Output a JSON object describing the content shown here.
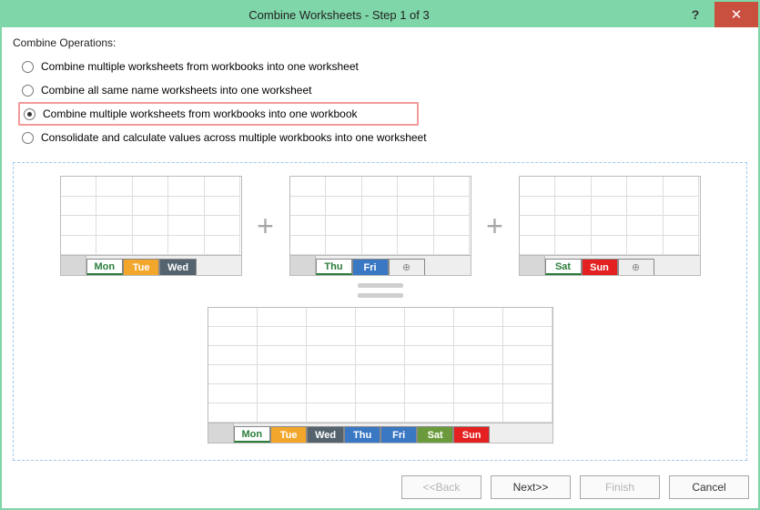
{
  "window": {
    "title": "Combine Worksheets - Step 1 of 3"
  },
  "group_label": "Combine Operations:",
  "options": [
    {
      "label": "Combine multiple worksheets from workbooks into one worksheet",
      "selected": false,
      "highlight": false
    },
    {
      "label": "Combine all same name worksheets into one worksheet",
      "selected": false,
      "highlight": false
    },
    {
      "label": "Combine multiple worksheets from workbooks into one workbook",
      "selected": true,
      "highlight": true
    },
    {
      "label": "Consolidate and calculate values across multiple workbooks into one worksheet",
      "selected": false,
      "highlight": false
    }
  ],
  "diagram": {
    "source_workbooks": [
      {
        "tabs": [
          {
            "text": "Mon",
            "style": "green"
          },
          {
            "text": "Tue",
            "style": "orange"
          },
          {
            "text": "Wed",
            "style": "slate"
          }
        ]
      },
      {
        "tabs": [
          {
            "text": "Thu",
            "style": "green"
          },
          {
            "text": "Fri",
            "style": "blue"
          },
          {
            "text": "+",
            "style": "plus"
          }
        ]
      },
      {
        "tabs": [
          {
            "text": "Sat",
            "style": "green"
          },
          {
            "text": "Sun",
            "style": "red"
          },
          {
            "text": "+",
            "style": "plus"
          }
        ]
      }
    ],
    "result_workbook": {
      "tabs": [
        {
          "text": "Mon",
          "style": "green"
        },
        {
          "text": "Tue",
          "style": "orange"
        },
        {
          "text": "Wed",
          "style": "slate"
        },
        {
          "text": "Thu",
          "style": "blue"
        },
        {
          "text": "Fri",
          "style": "blue"
        },
        {
          "text": "Sat",
          "style": "olive"
        },
        {
          "text": "Sun",
          "style": "red"
        }
      ]
    }
  },
  "footer": {
    "back": "<<Back",
    "next": "Next>>",
    "finish": "Finish",
    "cancel": "Cancel"
  }
}
